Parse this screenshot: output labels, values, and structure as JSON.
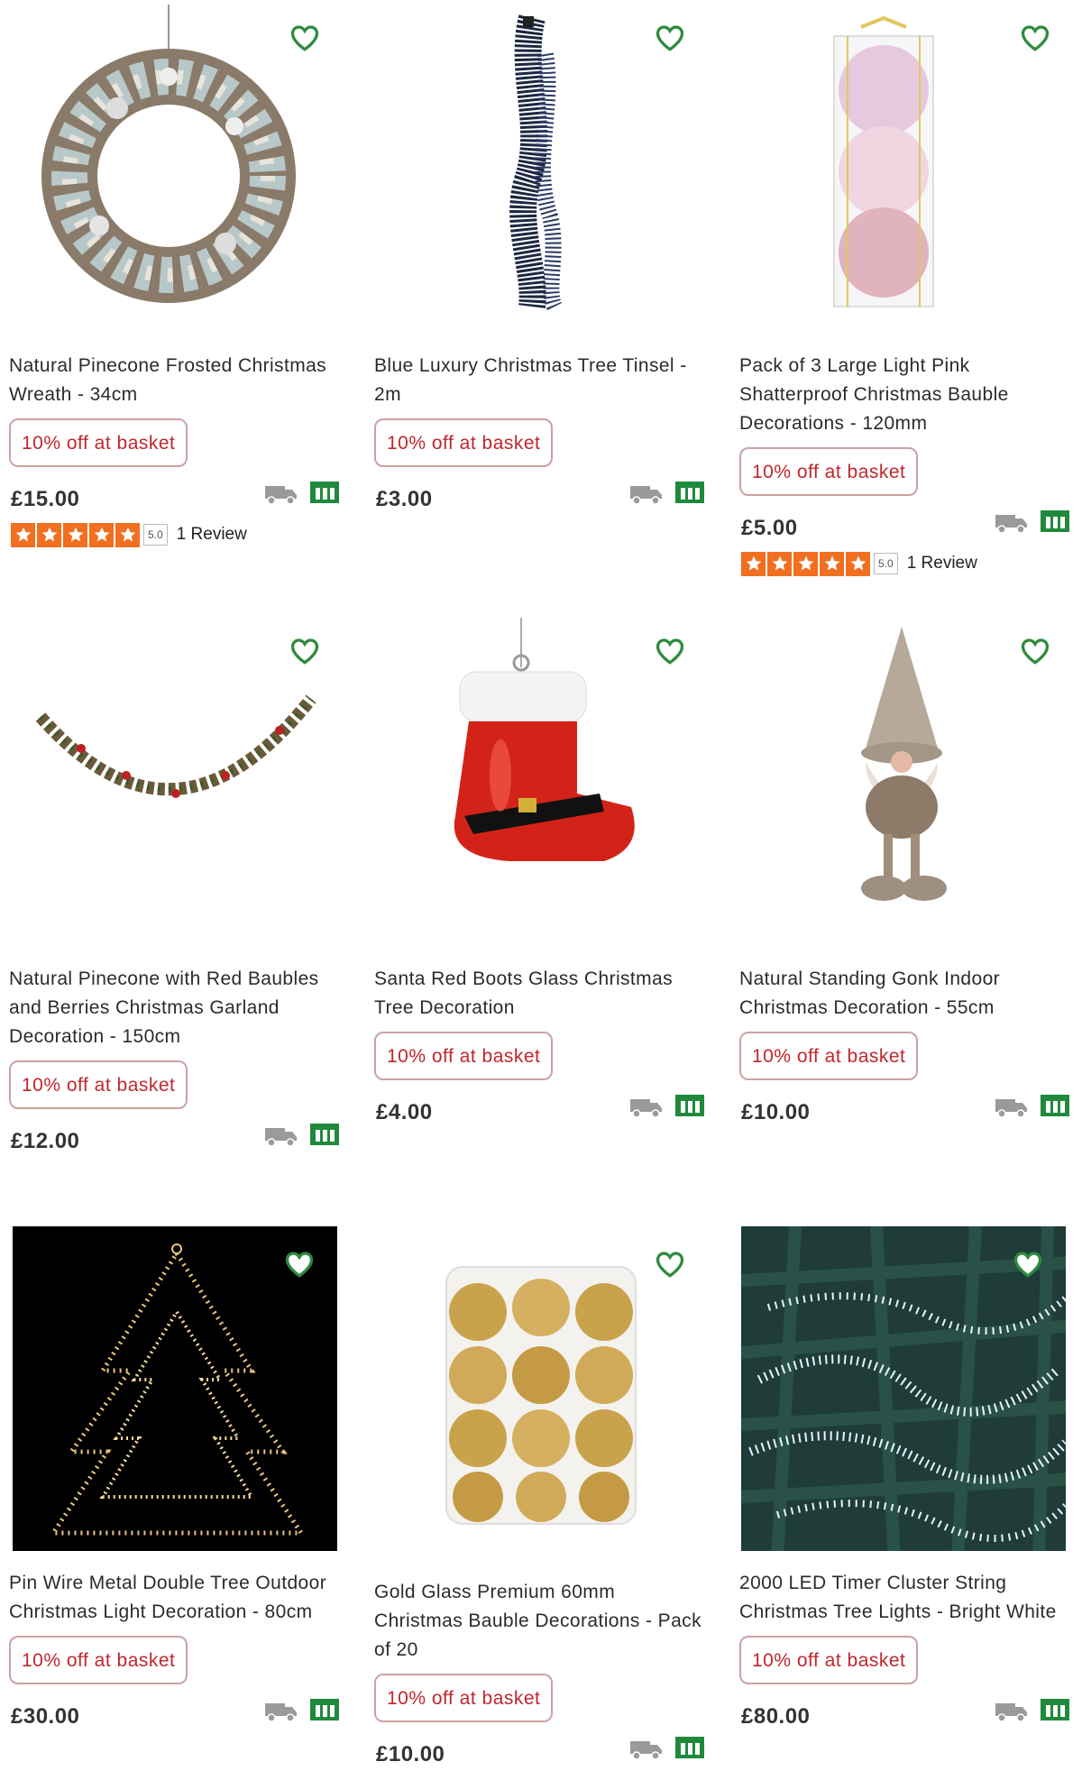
{
  "colors": {
    "accent_green": "#2e8b3e",
    "badge_red": "#c0262d",
    "star_orange": "#f06f20"
  },
  "products": [
    {
      "title": "Natural Pinecone Frosted Christmas Wreath - 34cm",
      "promo": "10% off at basket",
      "price": "£15.00",
      "rating_score": "5.0",
      "rating_reviews": "1 Review",
      "image": "wreath",
      "icons": [
        "delivery-truck-icon",
        "click-collect-store-icon",
        "heart-outline-icon"
      ]
    },
    {
      "title": "Blue Luxury Christmas Tree Tinsel - 2m",
      "promo": "10% off at basket",
      "price": "£3.00",
      "image": "tinsel"
    },
    {
      "title": "Pack of 3 Large Light Pink Shatterproof Christmas Bauble Decorations - 120mm",
      "promo": "10% off at basket",
      "price": "£5.00",
      "rating_score": "5.0",
      "rating_reviews": "1 Review",
      "image": "pink-baubles"
    },
    {
      "title": "Natural Pinecone with Red Baubles and Berries Christmas Garland Decoration - 150cm",
      "promo": "10% off at basket",
      "price": "£12.00",
      "image": "garland"
    },
    {
      "title": "Santa Red Boots Glass Christmas Tree Decoration",
      "promo": "10% off at basket",
      "price": "£4.00",
      "image": "boots"
    },
    {
      "title": "Natural Standing Gonk Indoor Christmas Decoration - 55cm",
      "promo": "10% off at basket",
      "price": "£10.00",
      "image": "gonk"
    },
    {
      "title": "Pin Wire Metal Double Tree Outdoor Christmas Light Decoration - 80cm",
      "promo": "10% off at basket",
      "price": "£30.00",
      "image": "light-tree"
    },
    {
      "title": "Gold Glass Premium 60mm Christmas Bauble Decorations - Pack of 20",
      "promo": "10% off at basket",
      "price": "£10.00",
      "image": "gold-baubles"
    },
    {
      "title": "2000 LED Timer Cluster String Christmas Tree Lights - Bright White",
      "promo": "10% off at basket",
      "price": "£80.00",
      "image": "cluster-lights"
    }
  ]
}
